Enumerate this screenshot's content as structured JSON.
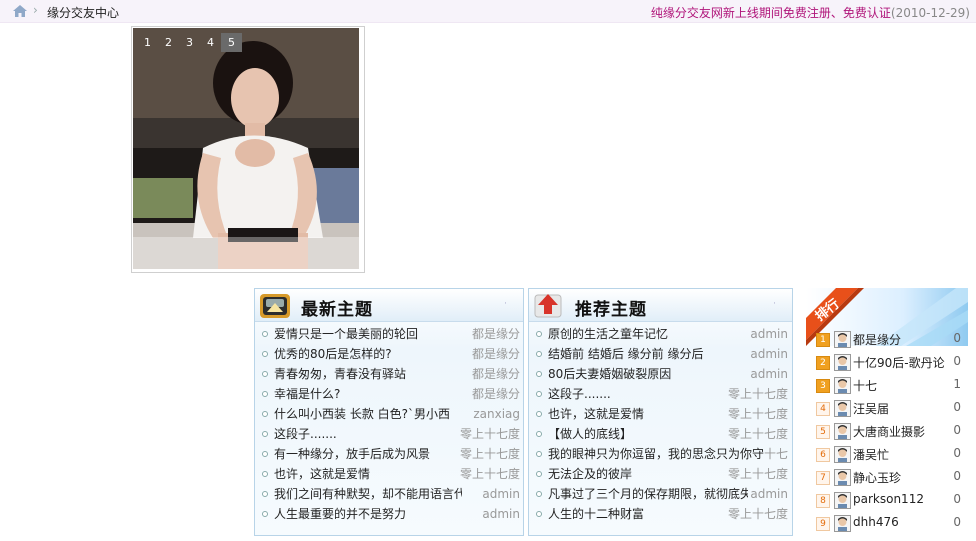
{
  "header": {
    "breadcrumb": "缘分交友中心",
    "notice": "纯缘分交友网新上线期间免费注册、免费认证",
    "date": "(2010-12-29)"
  },
  "slideshow": {
    "pages": [
      "1",
      "2",
      "3",
      "4",
      "5"
    ],
    "active_page": "5"
  },
  "latest": {
    "title": "最新主题",
    "threads": [
      {
        "title": "爱情只是一个最美丽的轮回",
        "author": "都是缘分"
      },
      {
        "title": "优秀的80后是怎样的?",
        "author": "都是缘分"
      },
      {
        "title": "青春匆匆，青春没有驿站",
        "author": "都是缘分"
      },
      {
        "title": "幸福是什么?",
        "author": "都是缘分"
      },
      {
        "title": "什么叫小西装 长款 白色?`男小西",
        "author": "zanxiag"
      },
      {
        "title": "这段子.......",
        "author": "零上十七度"
      },
      {
        "title": "有一种缘分，放手后成为风景",
        "author": "零上十七度"
      },
      {
        "title": "也许，这就是爱情",
        "author": "零上十七度"
      },
      {
        "title": "我们之间有种默契，却不能用语言代",
        "author": "admin"
      },
      {
        "title": "人生最重要的并不是努力",
        "author": "admin"
      }
    ]
  },
  "recommended": {
    "title": "推荐主题",
    "threads": [
      {
        "title": "原创的生活之童年记忆",
        "author": "admin"
      },
      {
        "title": "结婚前 结婚后 缘分前 缘分后",
        "author": "admin"
      },
      {
        "title": "80后夫妻婚姻破裂原因",
        "author": "admin"
      },
      {
        "title": "这段子.......",
        "author": "零上十七度"
      },
      {
        "title": "也许，这就是爱情",
        "author": "零上十七度"
      },
      {
        "title": "【做人的底线】",
        "author": "零上十七度"
      },
      {
        "title": "我的眼神只为你逗留，我的思念只为你守",
        "author": "十七"
      },
      {
        "title": "无法企及的彼岸",
        "author": "零上十七度"
      },
      {
        "title": "凡事过了三个月的保存期限，就彻底失",
        "author": "admin"
      },
      {
        "title": "人生的十二种财富",
        "author": "零上十七度"
      }
    ]
  },
  "ranking": {
    "title": "排行",
    "items": [
      {
        "rank": "1",
        "name": "都是缘分",
        "count": "0"
      },
      {
        "rank": "2",
        "name": "十亿90后-歌丹论",
        "count": "0"
      },
      {
        "rank": "3",
        "name": "十七",
        "count": "1"
      },
      {
        "rank": "4",
        "name": "汪吴届",
        "count": "0"
      },
      {
        "rank": "5",
        "name": "大唐商业摄影",
        "count": "0"
      },
      {
        "rank": "6",
        "name": "潘吴忙",
        "count": "0"
      },
      {
        "rank": "7",
        "name": "静心玉珍",
        "count": "0"
      },
      {
        "rank": "8",
        "name": "parkson112",
        "count": "0"
      },
      {
        "rank": "9",
        "name": "dhh476",
        "count": "0"
      }
    ]
  },
  "colors": {
    "notice": "#b0157a",
    "panel_border": "#b8d4e8",
    "rank_badge": "#f0a020"
  }
}
